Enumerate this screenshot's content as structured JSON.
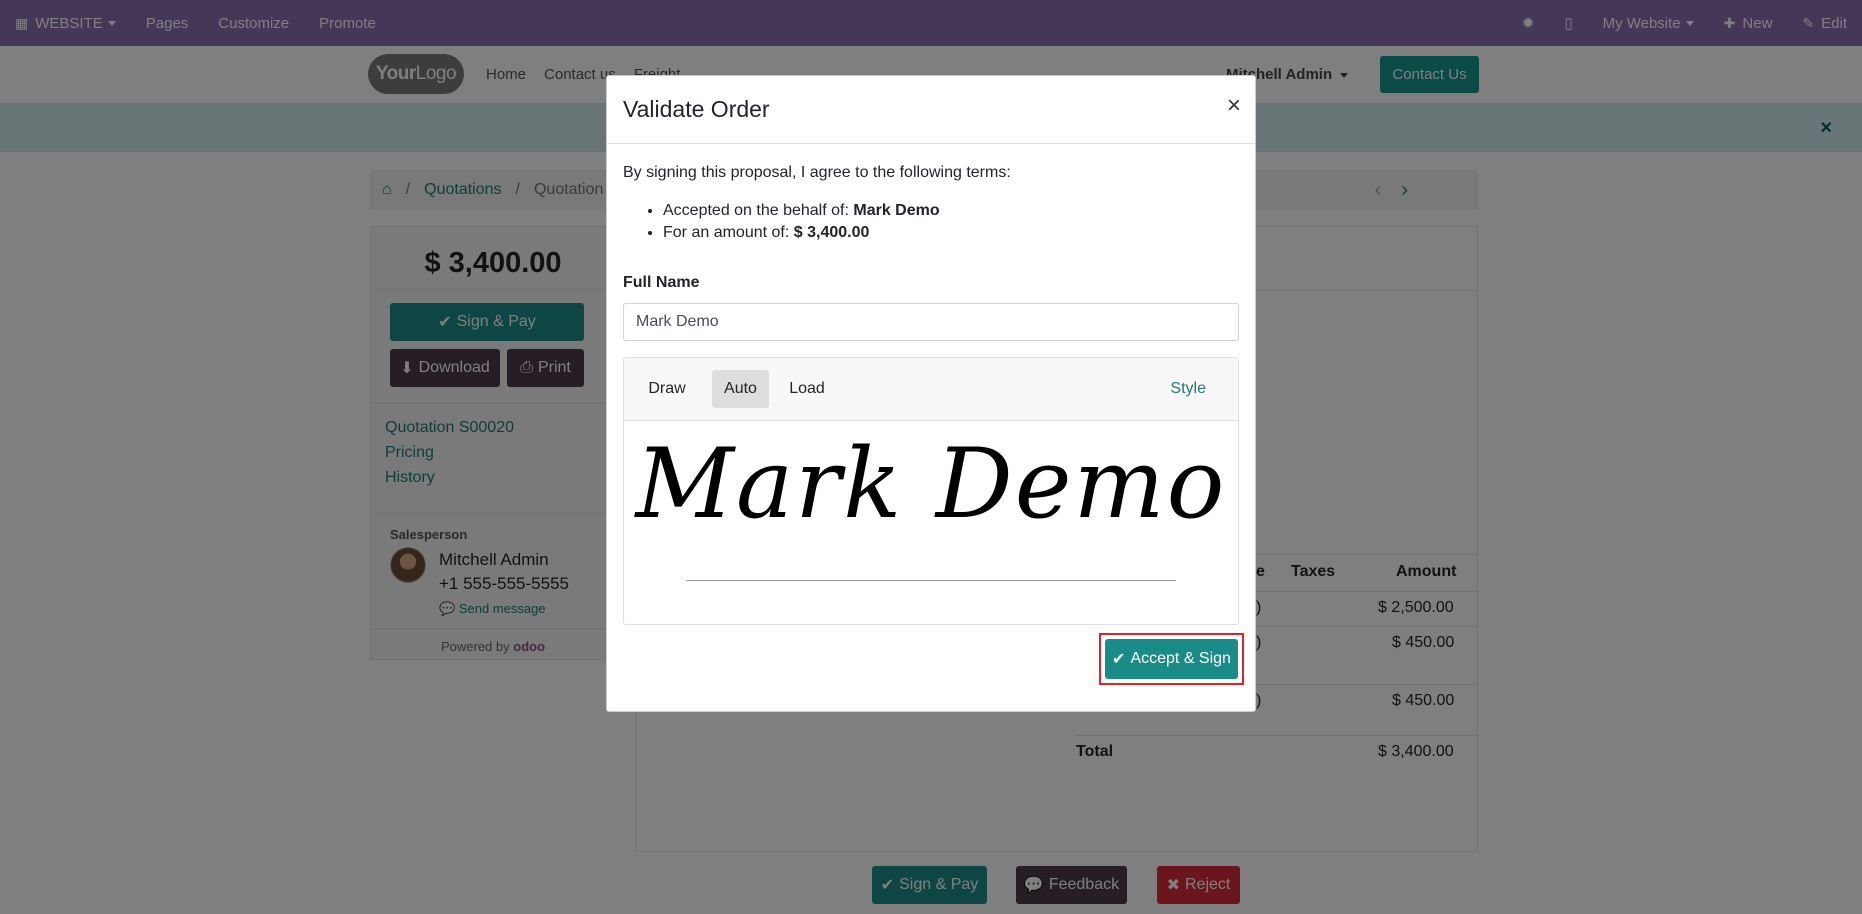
{
  "topbar": {
    "website": "WEBSITE",
    "pages": "Pages",
    "customize": "Customize",
    "promote": "Promote",
    "my_website": "My Website",
    "new": "New",
    "edit": "Edit"
  },
  "header": {
    "logo_bold": "Your",
    "logo_thin": "Logo",
    "nav": [
      "Home",
      "Contact us",
      "Freight"
    ],
    "user": "Mitchell Admin",
    "contact_button": "Contact Us"
  },
  "breadcrumb": {
    "quotations": "Quotations",
    "current": "Quotation S..."
  },
  "sidebar": {
    "amount": "$ 3,400.00",
    "sign_pay": "Sign & Pay",
    "download": "Download",
    "print": "Print",
    "links": [
      "Quotation S00020",
      "Pricing",
      "History"
    ],
    "salesperson_label": "Salesperson",
    "salesperson_name": "Mitchell Admin",
    "salesperson_phone": "+1 555-555-5555",
    "send_message": "Send message",
    "powered_by": "Powered by",
    "powered_brand": "odoo"
  },
  "table": {
    "headers": {
      "price_partial": "e",
      "taxes": "Taxes",
      "amount": "Amount"
    },
    "rows": [
      {
        "partial": ")",
        "amount": "$ 2,500.00"
      },
      {
        "partial": ")",
        "amount": "$ 450.00"
      },
      {
        "partial": ")",
        "amount": "$ 450.00"
      }
    ],
    "total_label": "Total",
    "total_value": "$ 3,400.00"
  },
  "bottom_buttons": {
    "sign_pay": "Sign & Pay",
    "feedback": "Feedback",
    "reject": "Reject"
  },
  "modal": {
    "title": "Validate Order",
    "close": "×",
    "intro": "By signing this proposal, I agree to the following terms:",
    "term1_prefix": "Accepted on the behalf of:",
    "term1_value": "Mark Demo",
    "term2_prefix": "For an amount of:",
    "term2_value": "$ 3,400.00",
    "full_name_label": "Full Name",
    "full_name_value": "Mark Demo",
    "tabs": [
      "Draw",
      "Auto",
      "Load"
    ],
    "active_tab": "Auto",
    "style_link": "Style",
    "signature_text": "Mark Demo",
    "accept_button": "Accept & Sign"
  },
  "colors": {
    "topbar": "#8a6fb0",
    "primary": "#1a8c88",
    "secondary": "#4d3b4a",
    "danger": "#d62a39",
    "highlight": "#e0222b"
  }
}
